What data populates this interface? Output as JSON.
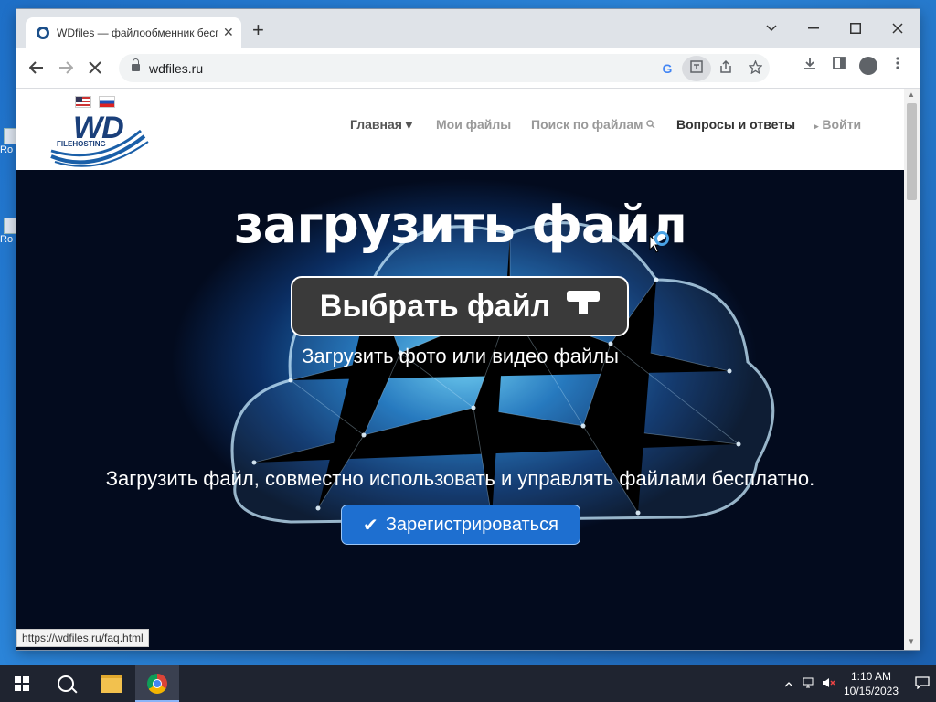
{
  "browser": {
    "tab_title": "WDfiles — файлообменник бесплатный",
    "url": "wdfiles.ru",
    "new_tab": "+",
    "tab_close": "✕",
    "window_controls": [
      "chevron-down-icon",
      "minimize-icon",
      "maximize-icon",
      "close-icon"
    ]
  },
  "site": {
    "logo_text": "WD",
    "logo_sub": "FILEHOSTING",
    "nav": {
      "home": "Главная ▾",
      "my_files": "Мои файлы",
      "search": "Поиск по файлам",
      "faq": "Вопросы и ответы",
      "login": "Войти"
    }
  },
  "hero": {
    "title": "загрузить файл",
    "choose_button": "Выбрать файл",
    "subtitle": "Загрузить фото или видео файлы",
    "description": "Загрузить файл, совместно использовать и управлять файлами бесплатно.",
    "register_button": "Зарегистрироваться"
  },
  "status_bar": {
    "hover_url": "https://wdfiles.ru/faq.html"
  },
  "taskbar": {
    "time": "1:10 AM",
    "date": "10/15/2023"
  },
  "desktop": {
    "icon_labels": [
      "Ro",
      "Ro"
    ]
  },
  "colors": {
    "accent": "#1e6fd0",
    "desktop": "#2b84d8",
    "hero_dark": "#0b2e63"
  }
}
